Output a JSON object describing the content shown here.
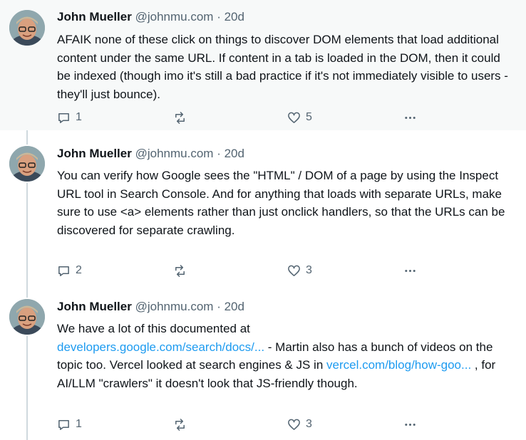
{
  "colors": {
    "text": "#0f1419",
    "secondary": "#536471",
    "link": "#1d9bf0",
    "highlight_bg": "#f7f9f9",
    "thread_line": "#cfd9de"
  },
  "icons": {
    "reply": "reply-bubble-icon",
    "retweet": "retweet-arrows-icon",
    "like": "heart-icon",
    "more": "more-dots-icon"
  },
  "tweets": [
    {
      "author_name": "John Mueller",
      "handle": "@johnmu.com",
      "separator": "·",
      "time": "20d",
      "text": "AFAIK none of these click on things to discover DOM elements that load additional content under the same URL. If content in a tab is loaded in the DOM, then it could be indexed (though imo it's still a bad practice if it's not immediately visible to users - they'll just bounce).",
      "reply_count": "1",
      "like_count": "5"
    },
    {
      "author_name": "John Mueller",
      "handle": "@johnmu.com",
      "separator": "·",
      "time": "20d",
      "text": "You can verify how Google sees the \"HTML\" / DOM of a page by using the Inspect URL tool in Search Console. And for anything that loads with separate URLs, make sure to use <a> elements rather than just onclick handlers, so that the URLs can be discovered for separate crawling.",
      "reply_count": "2",
      "like_count": "3"
    },
    {
      "author_name": "John Mueller",
      "handle": "@johnmu.com",
      "separator": "·",
      "time": "20d",
      "text_before_link1": "We have a lot of this documented at",
      "link1": "developers.google.com/search/docs/...",
      "text_after_link1": " - Martin also has a bunch of videos on the topic too. Vercel looked at search engines & JS in ",
      "link2": "vercel.com/blog/how-goo...",
      "text_after_link2": " , for AI/LLM \"crawlers\" it doesn't look that JS-friendly though.",
      "reply_count": "1",
      "like_count": "3"
    }
  ]
}
